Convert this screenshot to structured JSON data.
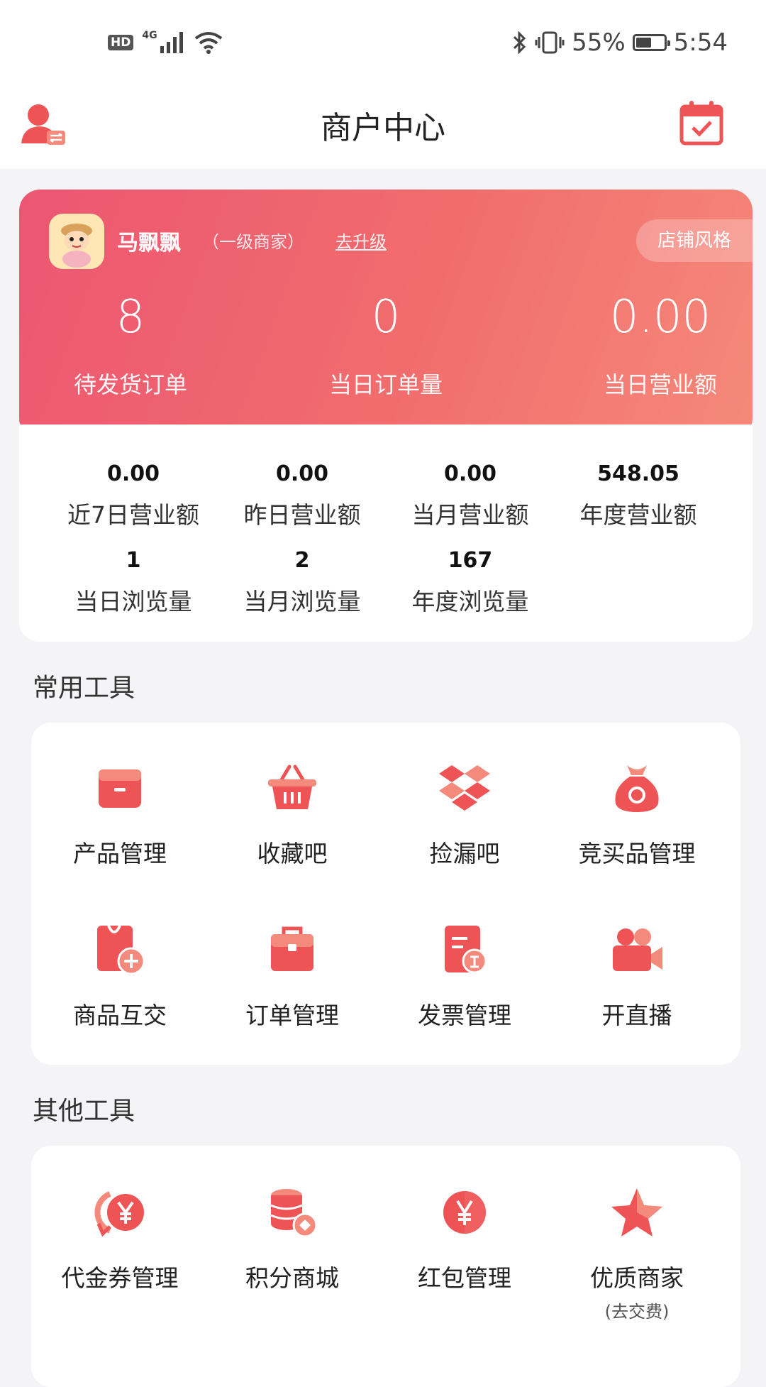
{
  "status_bar": {
    "hd": "HD",
    "network": "4G",
    "battery": "55%",
    "battery_level": 0.55,
    "time": "5:54"
  },
  "header": {
    "title": "商户中心"
  },
  "shop": {
    "name": "马飘飘",
    "level": "（一级商家）",
    "upgrade": "去升级",
    "style_button": "店铺风格"
  },
  "kpis": [
    {
      "value": "8",
      "label": "待发货订单"
    },
    {
      "value": "0",
      "label": "当日订单量"
    },
    {
      "value": "0.00",
      "label": "当日营业额"
    }
  ],
  "stats": [
    {
      "value": "0.00",
      "label": "近7日营业额"
    },
    {
      "value": "0.00",
      "label": "昨日营业额"
    },
    {
      "value": "0.00",
      "label": "当月营业额"
    },
    {
      "value": "548.05",
      "label": "年度营业额"
    },
    {
      "value": "1",
      "label": "当日浏览量"
    },
    {
      "value": "2",
      "label": "当月浏览量"
    },
    {
      "value": "167",
      "label": "年度浏览量"
    }
  ],
  "common_tools": {
    "title": "常用工具",
    "items": [
      {
        "label": "产品管理",
        "icon": "box-icon"
      },
      {
        "label": "收藏吧",
        "icon": "basket-icon"
      },
      {
        "label": "捡漏吧",
        "icon": "dropbox-icon"
      },
      {
        "label": "竞买品管理",
        "icon": "money-bag-icon"
      },
      {
        "label": "商品互交",
        "icon": "tag-plus-icon"
      },
      {
        "label": "订单管理",
        "icon": "toolbox-icon"
      },
      {
        "label": "发票管理",
        "icon": "invoice-icon"
      },
      {
        "label": "开直播",
        "icon": "video-camera-icon"
      }
    ]
  },
  "other_tools": {
    "title": "其他工具",
    "items": [
      {
        "label": "代金券管理",
        "icon": "coupon-yen-icon"
      },
      {
        "label": "积分商城",
        "icon": "coins-stack-icon"
      },
      {
        "label": "红包管理",
        "icon": "red-packet-icon"
      },
      {
        "label": "优质商家",
        "sub": "(去交费)",
        "icon": "star-icon"
      }
    ]
  },
  "colors": {
    "accent": "#ec5672",
    "accent2": "#f5897a",
    "icon": "#ee5455"
  }
}
